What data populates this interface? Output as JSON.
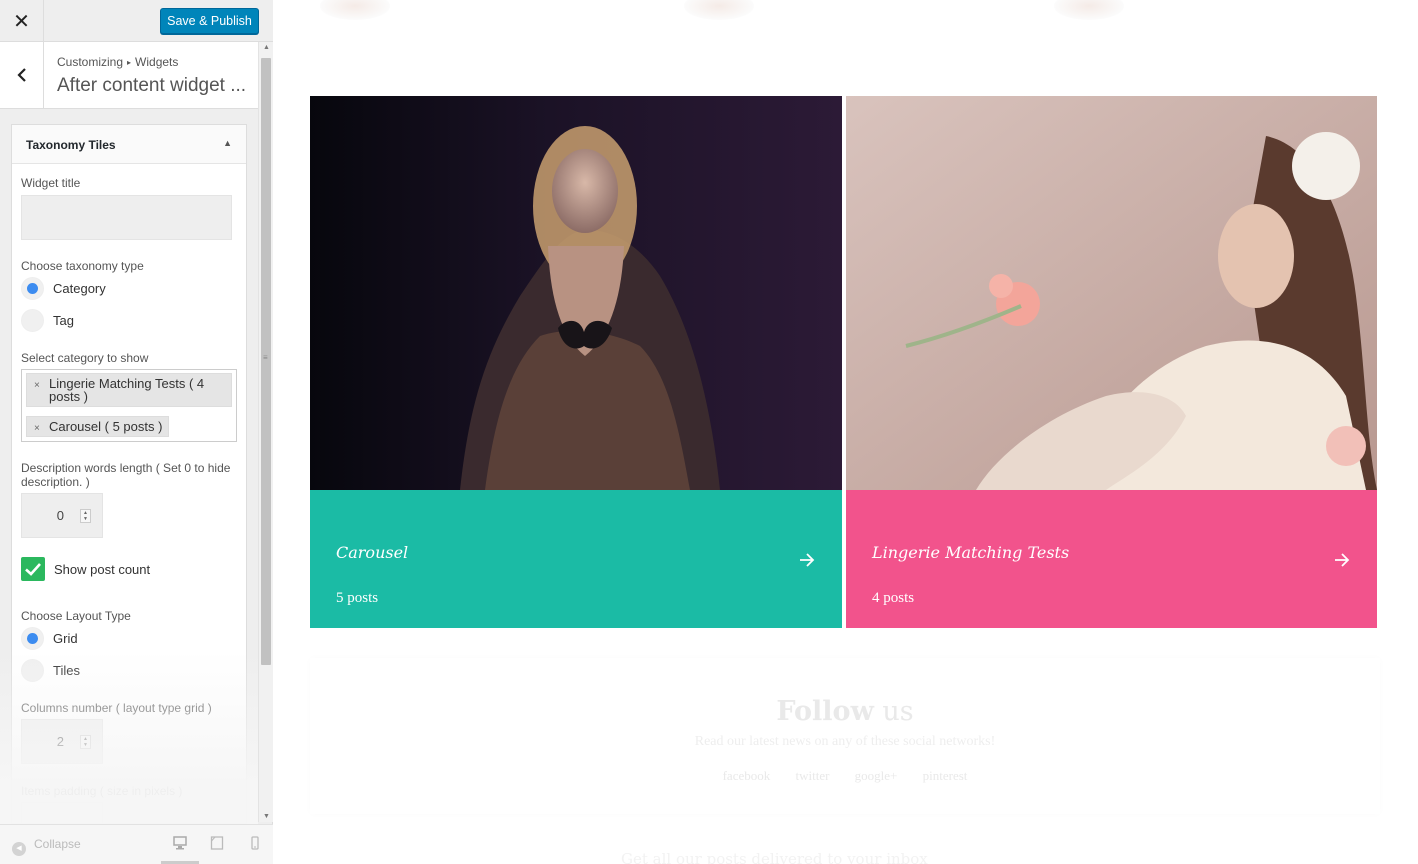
{
  "topbar": {
    "close_glyph": "✕",
    "publish_label": "Save & Publish"
  },
  "header": {
    "crumb_1": "Customizing",
    "crumb_sep": "▸",
    "crumb_2": "Widgets",
    "title": "After content widget ..."
  },
  "widget": {
    "name": "Taxonomy Tiles",
    "toggle_glyph": "▲",
    "title_label": "Widget title",
    "title_value": "",
    "taxonomy_label": "Choose taxonomy type",
    "taxonomy_options": [
      "Category",
      "Tag"
    ],
    "taxonomy_selected": "Category",
    "category_label": "Select category to show",
    "selected_categories": [
      {
        "line1": "Lingerie Matching Tests ( 4",
        "line2": "posts )"
      },
      {
        "line1": "Carousel ( 5 posts )"
      }
    ],
    "remove_glyph": "×",
    "desc_label_1": "Description words length ( Set 0 to hide",
    "desc_label_2": "description. )",
    "desc_value": "0",
    "show_count_label": "Show post count",
    "show_count_checked": true,
    "layout_label": "Choose Layout Type",
    "layout_options": [
      "Grid",
      "Tiles"
    ],
    "layout_selected": "Grid",
    "columns_label": "Columns number ( layout type grid )",
    "columns_value": "2",
    "padding_label": "Items padding ( size in pixels )"
  },
  "footer": {
    "collapse_label": "Collapse"
  },
  "preview": {
    "tiles": [
      {
        "name": "Carousel",
        "count": "5 posts",
        "color": "#1bbba5"
      },
      {
        "name": "Lingerie Matching Tests",
        "count": "4 posts",
        "color": "#f2538c"
      }
    ],
    "follow_title_bold": "Follow",
    "follow_title_rest": " us",
    "follow_sub": "Read our latest news on any of these social networks!",
    "social_links": [
      "facebook",
      "twitter",
      "google+",
      "pinterest"
    ],
    "bottom_faded": "Get all our posts delivered to your inbox"
  },
  "colors": {
    "accent": "#0085ba",
    "radio_on": "#3c8cf0",
    "checkbox": "#2bb85e"
  }
}
